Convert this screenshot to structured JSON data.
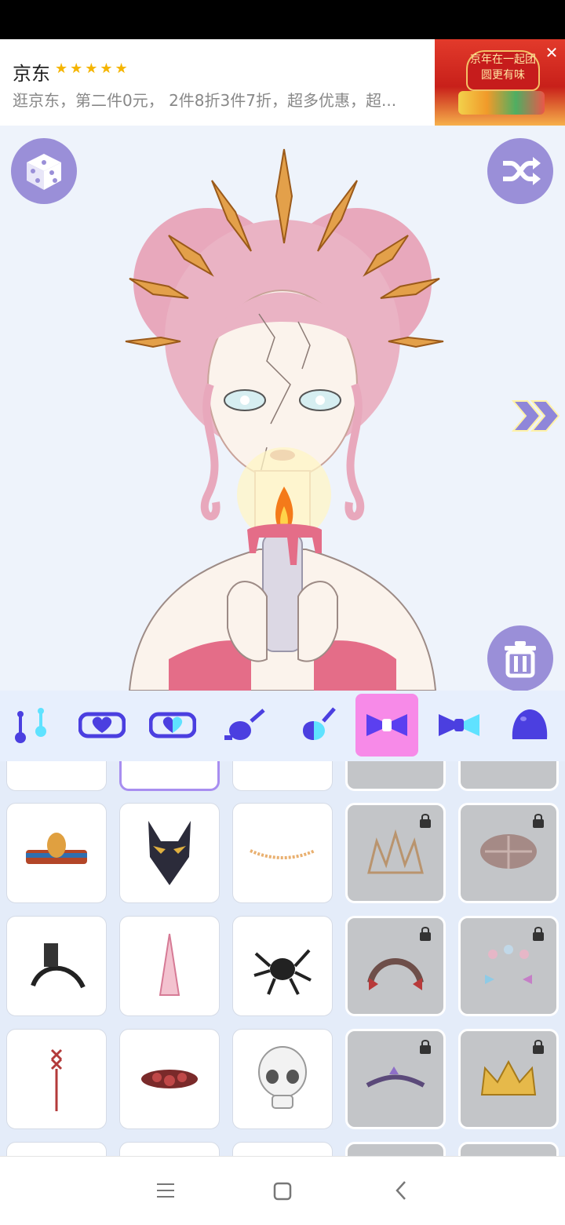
{
  "ad": {
    "title": "京东",
    "stars": "★★★★★",
    "description": "逛京东，第二件0元， 2件8折3件7折，超多优惠，超...",
    "image_banner": "京年在一起团圆更有味",
    "close_glyph": "✕"
  },
  "stage": {
    "dice_icon": "dice-icon",
    "shuffle_icon": "shuffle-icon",
    "next_icon": "double-chevron-right-icon",
    "trash_icon": "trash-icon"
  },
  "tabs": [
    {
      "name": "earrings",
      "active": false
    },
    {
      "name": "necklace-heart",
      "active": false
    },
    {
      "name": "necklace-half-heart",
      "active": false
    },
    {
      "name": "headwear",
      "active": false
    },
    {
      "name": "headwear-alt",
      "active": false
    },
    {
      "name": "bow",
      "active": true
    },
    {
      "name": "bow-alt",
      "active": false
    },
    {
      "name": "hat",
      "active": false
    }
  ],
  "items": [
    {
      "name": "cobra-crown",
      "locked": false
    },
    {
      "name": "anubis-mask",
      "locked": false
    },
    {
      "name": "flower-vine",
      "locked": false
    },
    {
      "name": "candle-tiara",
      "locked": true
    },
    {
      "name": "plaid-beret",
      "locked": true
    },
    {
      "name": "rook-headband",
      "locked": false
    },
    {
      "name": "unicorn-horn",
      "locked": false
    },
    {
      "name": "spider",
      "locked": false
    },
    {
      "name": "lace-headband",
      "locked": true
    },
    {
      "name": "bow-clips",
      "locked": true
    },
    {
      "name": "ribbon-lace",
      "locked": false
    },
    {
      "name": "rose-wreath",
      "locked": false
    },
    {
      "name": "skull",
      "locked": false
    },
    {
      "name": "jewel-tiara",
      "locked": true
    },
    {
      "name": "gold-crown",
      "locked": true
    }
  ],
  "colors": {
    "accent": "#9a8fd8",
    "tab_active": "#f78ae8",
    "icon_blue": "#4b3fe0",
    "icon_cyan": "#5fe2ff"
  }
}
